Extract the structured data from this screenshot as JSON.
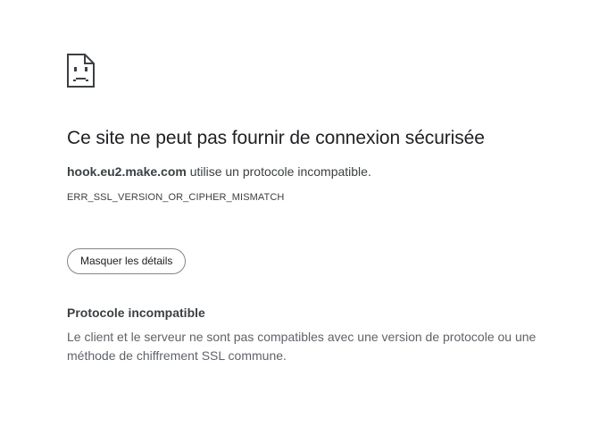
{
  "error": {
    "icon": "broken-page-icon",
    "title": "Ce site ne peut pas fournir de connexion sécurisée",
    "host": "hook.eu2.make.com",
    "summary_suffix": " utilise un protocole incompatible.",
    "code": "ERR_SSL_VERSION_OR_CIPHER_MISMATCH",
    "details_button_label": "Masquer les détails",
    "details_title": "Protocole incompatible",
    "details_text": "Le client et le serveur ne sont pas compatibles avec une version de protocole ou une méthode de chiffrement SSL commune."
  },
  "colors": {
    "text_primary": "#202124",
    "text_secondary": "#3c4043",
    "text_muted": "#5f6368",
    "button_border": "#80868b"
  }
}
